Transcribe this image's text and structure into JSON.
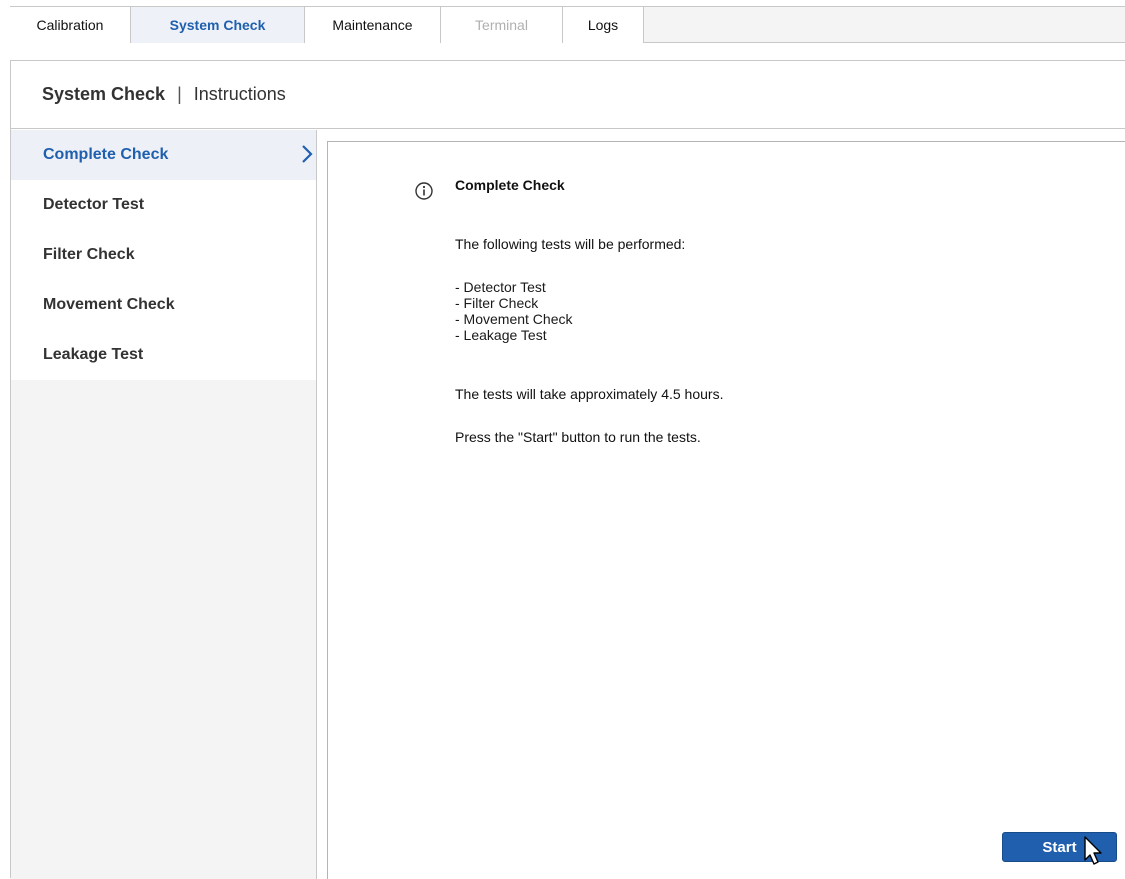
{
  "tabs": [
    {
      "label": "Calibration",
      "state": "normal"
    },
    {
      "label": "System Check",
      "state": "active"
    },
    {
      "label": "Maintenance",
      "state": "normal"
    },
    {
      "label": "Terminal",
      "state": "disabled"
    },
    {
      "label": "Logs",
      "state": "normal"
    }
  ],
  "header": {
    "title": "System Check",
    "separator": "|",
    "subtitle": "Instructions"
  },
  "sidebar": {
    "items": [
      {
        "label": "Complete Check",
        "active": true
      },
      {
        "label": "Detector Test",
        "active": false
      },
      {
        "label": "Filter Check",
        "active": false
      },
      {
        "label": "Movement Check",
        "active": false
      },
      {
        "label": "Leakage Test",
        "active": false
      }
    ]
  },
  "content": {
    "title": "Complete Check",
    "intro": "The following tests will be performed:",
    "tests": [
      "- Detector Test",
      "- Filter Check",
      "- Movement Check",
      "- Leakage Test"
    ],
    "duration": "The tests will take approximately 4.5 hours.",
    "instruction": "Press the \"Start\" button to run the tests."
  },
  "start_button": {
    "label": "Start"
  },
  "colors": {
    "accent": "#1f5fae",
    "active_background": "#edf1f7",
    "disabled_text": "#b0b0b0",
    "border": "#c8c8c8"
  },
  "icons": {
    "info": "info-circle-icon",
    "chevron": "chevron-right-icon",
    "cursor": "mouse-pointer-icon"
  }
}
